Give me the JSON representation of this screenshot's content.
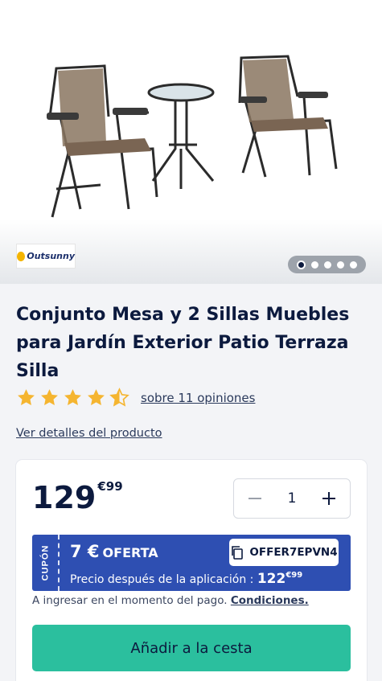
{
  "brand": {
    "name": "Outsunny"
  },
  "gallery": {
    "total_images": 5,
    "active_index": 0
  },
  "product": {
    "title": "Conjunto Mesa y 2 Sillas Muebles para Jardín Exterior Patio Terraza Silla",
    "rating": 4.5,
    "reviews_label": "sobre 11 opiniones",
    "details_link": "Ver detalles del producto"
  },
  "price": {
    "integer": "129",
    "decimal": "€99"
  },
  "quantity": {
    "value": "1",
    "minus": "−",
    "plus": "+"
  },
  "coupon": {
    "side_label": "CUPÓN",
    "amount": "7 €",
    "label": "OFERTA",
    "code": "OFFER7EPVN4",
    "after_label": "Precio después de la aplicación :",
    "after_value": "122",
    "after_decimal": "€99"
  },
  "payment_note": {
    "text": "A ingresar en el momento del pago.",
    "link": "Condiciones."
  },
  "add_to_cart": "Añadir a la cesta",
  "colors": {
    "primary": "#0c1a3e",
    "coupon": "#2e4fb2",
    "cta": "#2bbf9e",
    "star": "#f5b530"
  },
  "icons": {
    "star": "star-icon",
    "half_star": "star-half-icon",
    "copy": "copy-icon",
    "minus": "minus-icon",
    "plus": "plus-icon"
  }
}
